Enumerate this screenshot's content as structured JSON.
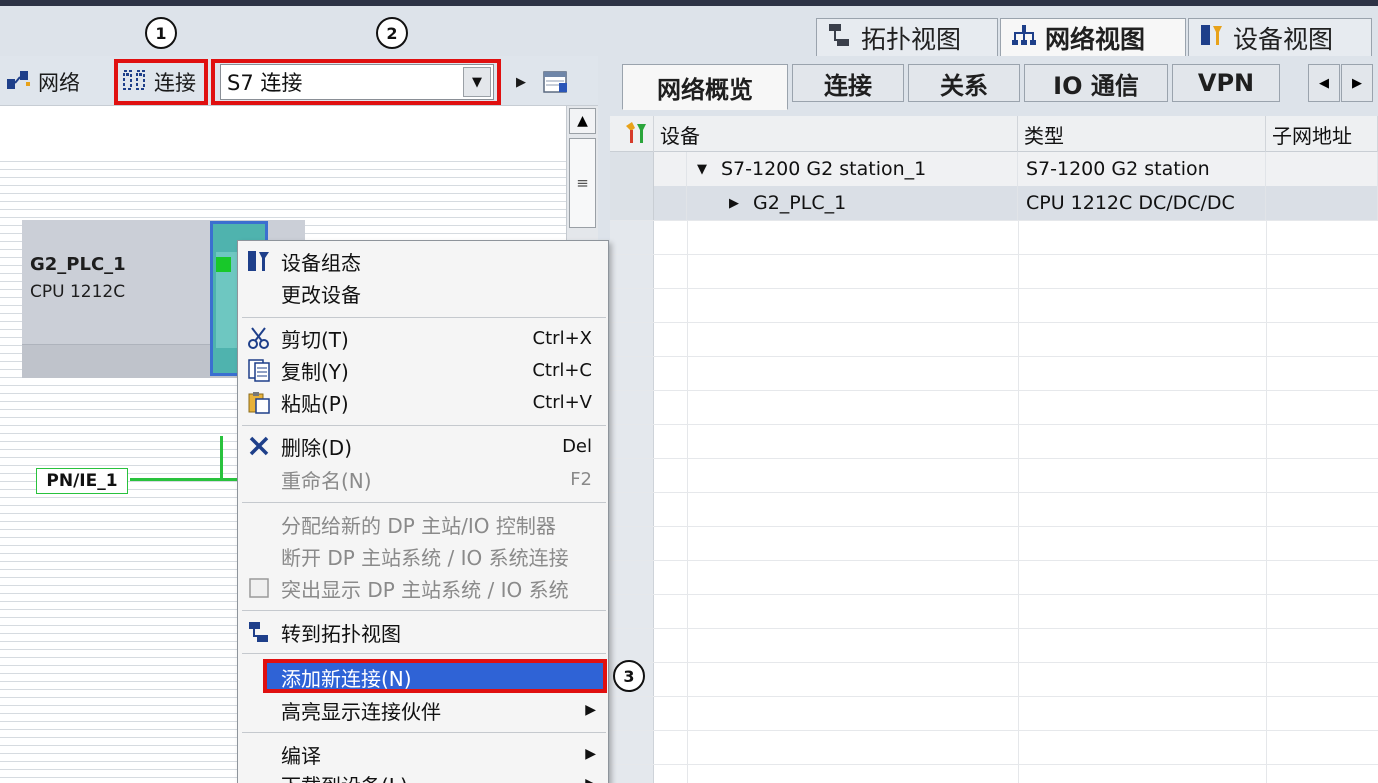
{
  "view_tabs": [
    {
      "label": "拓扑视图",
      "icon": "topology-icon"
    },
    {
      "label": "网络视图",
      "icon": "network-icon"
    },
    {
      "label": "设备视图",
      "icon": "device-icon"
    }
  ],
  "toolbar": {
    "network_label": "网络",
    "connection_label": "连接",
    "connection_type": "S7 连接"
  },
  "device": {
    "name": "G2_PLC_1",
    "cpu": "CPU 1212C"
  },
  "subnet": {
    "label": "PN/IE_1"
  },
  "context_menu": {
    "items": [
      {
        "label": "设备组态",
        "shortcut": "",
        "disabled": false
      },
      {
        "label": "更改设备",
        "shortcut": "",
        "disabled": false
      },
      {
        "label": "剪切(T)",
        "shortcut": "Ctrl+X",
        "disabled": false
      },
      {
        "label": "复制(Y)",
        "shortcut": "Ctrl+C",
        "disabled": false
      },
      {
        "label": "粘贴(P)",
        "shortcut": "Ctrl+V",
        "disabled": false
      },
      {
        "label": "删除(D)",
        "shortcut": "Del",
        "disabled": false
      },
      {
        "label": "重命名(N)",
        "shortcut": "F2",
        "disabled": true
      },
      {
        "label": "分配给新的 DP 主站/IO 控制器",
        "shortcut": "",
        "disabled": true
      },
      {
        "label": "断开 DP 主站系统 / IO 系统连接",
        "shortcut": "",
        "disabled": true
      },
      {
        "label": "突出显示 DP 主站系统 / IO 系统",
        "shortcut": "",
        "disabled": true
      },
      {
        "label": "转到拓扑视图",
        "shortcut": "",
        "disabled": false
      },
      {
        "label": "添加新连接(N)",
        "shortcut": "",
        "disabled": false
      },
      {
        "label": "高亮显示连接伙伴",
        "shortcut": "",
        "disabled": false
      },
      {
        "label": "编译",
        "shortcut": "",
        "disabled": false
      },
      {
        "label": "下载到设备(L)",
        "shortcut": "",
        "disabled": false
      }
    ]
  },
  "right_tabs": [
    "网络概览",
    "连接",
    "关系",
    "IO 通信",
    "VPN"
  ],
  "table": {
    "columns": [
      "设备",
      "类型",
      "子网地址"
    ],
    "rows": [
      {
        "device": "S7-1200 G2 station_1",
        "type": "S7-1200 G2 station",
        "subnet": ""
      },
      {
        "device": "G2_PLC_1",
        "type": "CPU 1212C DC/DC/DC",
        "subnet": ""
      }
    ]
  },
  "callouts": [
    "1",
    "2",
    "3"
  ],
  "colors": {
    "highlight_box": "#e01010",
    "menu_highlight": "#2f63d6",
    "network_line": "#29c23d"
  }
}
